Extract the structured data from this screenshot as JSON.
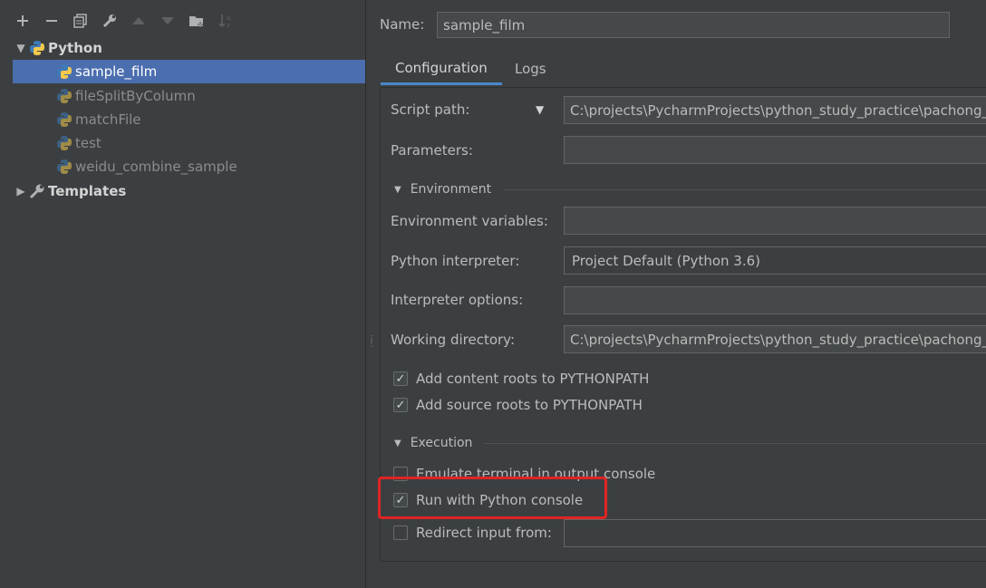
{
  "toolbar": {
    "add": "+",
    "remove": "−",
    "copy": "⧉",
    "edit": "🔧",
    "up": "▲",
    "down": "▼",
    "folder": "📁",
    "sort": "↓"
  },
  "tree": {
    "python_group": "Python",
    "items": [
      "sample_film",
      "fileSplitByColumn",
      "matchFile",
      "test",
      "weidu_combine_sample"
    ],
    "templates": "Templates"
  },
  "name_label": "Name:",
  "name_value": "sample_film",
  "tabs": [
    "Configuration",
    "Logs"
  ],
  "form": {
    "script_path_label": "Script path:",
    "script_path_value": "C:\\projects\\PycharmProjects\\python_study_practice\\pachong_p",
    "parameters_label": "Parameters:",
    "environment_section": "Environment",
    "env_vars_label": "Environment variables:",
    "interpreter_label": "Python interpreter:",
    "interpreter_value": "Project Default (Python 3.6)",
    "interp_options_label": "Interpreter options:",
    "working_dir_label": "Working directory:",
    "working_dir_value": "C:\\projects\\PycharmProjects\\python_study_practice\\pachong_p",
    "add_content_roots": "Add content roots to PYTHONPATH",
    "add_source_roots": "Add source roots to PYTHONPATH",
    "execution_section": "Execution",
    "emulate_terminal": "Emulate terminal in output console",
    "run_with_console": "Run with Python console",
    "redirect_input": "Redirect input from:"
  },
  "checkboxes": {
    "add_content_roots": true,
    "add_source_roots": true,
    "emulate_terminal": false,
    "run_with_console": true,
    "redirect_input": false
  },
  "colors": {
    "background": "#3c3f41",
    "selection": "#4b6eaf",
    "highlight_box": "#e02424",
    "tab_underline": "#4a88c7"
  }
}
